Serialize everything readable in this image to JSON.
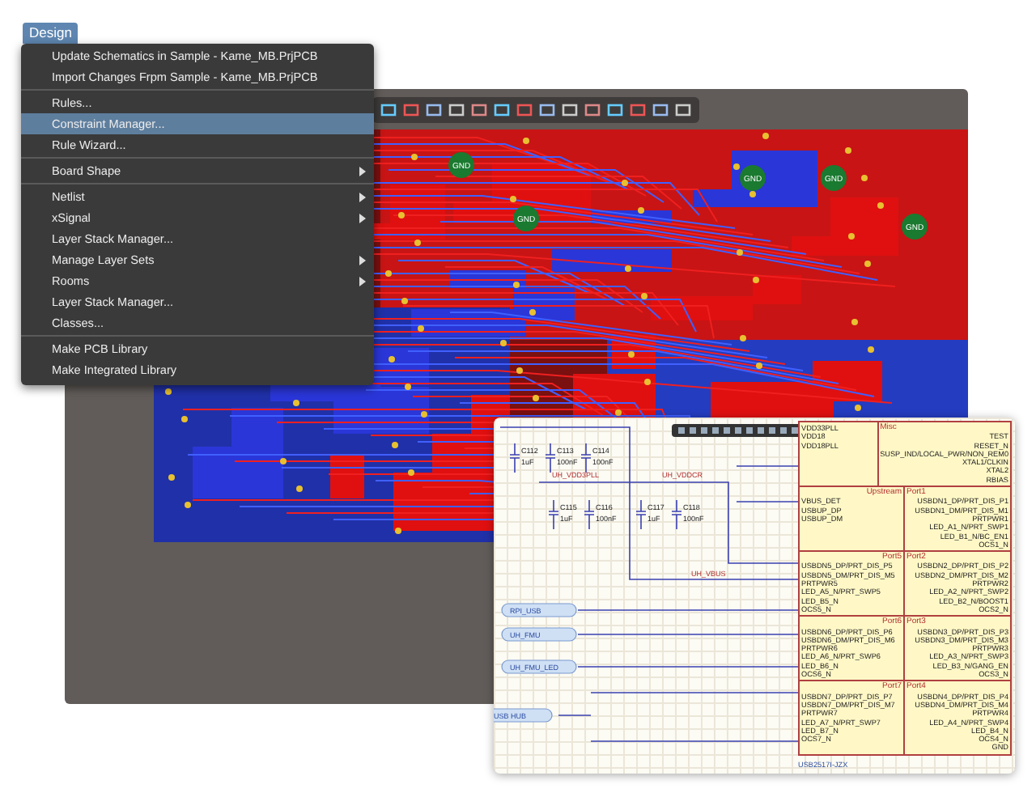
{
  "menu": {
    "title": "Design",
    "items": [
      {
        "label": "Update Schematics in Sample - Kame_MB.PrjPCB",
        "selected": false,
        "submenu": false,
        "group_start": false
      },
      {
        "label": "Import Changes Frpm Sample - Kame_MB.PrjPCB",
        "selected": false,
        "submenu": false,
        "group_start": false
      },
      {
        "label": "Rules...",
        "selected": false,
        "submenu": false,
        "group_start": true
      },
      {
        "label": "Constraint Manager...",
        "selected": true,
        "submenu": false,
        "group_start": false
      },
      {
        "label": "Rule Wizard...",
        "selected": false,
        "submenu": false,
        "group_start": false
      },
      {
        "label": "Board Shape",
        "selected": false,
        "submenu": true,
        "group_start": true
      },
      {
        "label": "Netlist",
        "selected": false,
        "submenu": true,
        "group_start": true
      },
      {
        "label": "xSignal",
        "selected": false,
        "submenu": true,
        "group_start": false
      },
      {
        "label": "Layer Stack Manager...",
        "selected": false,
        "submenu": false,
        "group_start": false
      },
      {
        "label": "Manage Layer Sets",
        "selected": false,
        "submenu": true,
        "group_start": false
      },
      {
        "label": "Rooms",
        "selected": false,
        "submenu": true,
        "group_start": false
      },
      {
        "label": "Layer Stack Manager...",
        "selected": false,
        "submenu": false,
        "group_start": false
      },
      {
        "label": "Classes...",
        "selected": false,
        "submenu": false,
        "group_start": false
      },
      {
        "label": "Make PCB Library",
        "selected": false,
        "submenu": false,
        "group_start": true
      },
      {
        "label": "Make Integrated Library",
        "selected": false,
        "submenu": false,
        "group_start": false
      }
    ]
  },
  "pcb": {
    "pads": [
      "GND",
      "GND",
      "GND",
      "GND",
      "GND"
    ]
  },
  "schematic": {
    "capacitors": [
      {
        "ref": "C112",
        "value": "1uF"
      },
      {
        "ref": "C113",
        "value": "100nF"
      },
      {
        "ref": "C114",
        "value": "100nF"
      },
      {
        "ref": "C115",
        "value": "1uF"
      },
      {
        "ref": "C116",
        "value": "100nF"
      },
      {
        "ref": "C117",
        "value": "1uF"
      },
      {
        "ref": "C118",
        "value": "100nF"
      }
    ],
    "net_labels": [
      "UH_VDD3PLL",
      "UH_VDDCR",
      "UH_VBUS"
    ],
    "harnesses": [
      "RPI_USB",
      "UH_FMU",
      "UH_FMU_LED",
      "USB HUB"
    ],
    "chip": {
      "part": "USB2517I-JZX",
      "sections": [
        {
          "left_pins": [
            "VDD33PLL",
            "VDD18",
            "VDD18PLL"
          ],
          "right_label": "Misc",
          "right_pins": [
            "TEST",
            "RESET_N",
            "SUSP_IND/LOCAL_PWR/NON_REM0",
            "XTAL1/CLKIN",
            "XTAL2",
            "RBIAS"
          ]
        },
        {
          "left_label": "Upstream",
          "left_pins": [
            "VBUS_DET",
            "USBUP_DP",
            "USBUP_DM"
          ],
          "right_label": "Port1",
          "right_pins": [
            "USBDN1_DP/PRT_DIS_P1",
            "USBDN1_DM/PRT_DIS_M1",
            "PRTPWR1",
            "LED_A1_N/PRT_SWP1",
            "LED_B1_N/BC_EN1",
            "OCS1_N"
          ]
        },
        {
          "left_label": "Port5",
          "left_pins": [
            "USBDN5_DP/PRT_DIS_P5",
            "USBDN5_DM/PRT_DIS_M5",
            "PRTPWR5",
            "LED_A5_N/PRT_SWP5",
            "LED_B5_N",
            "OCS5_N"
          ],
          "right_label": "Port2",
          "right_pins": [
            "USBDN2_DP/PRT_DIS_P2",
            "USBDN2_DM/PRT_DIS_M2",
            "PRTPWR2",
            "LED_A2_N/PRT_SWP2",
            "LED_B2_N/BOOST1",
            "OCS2_N"
          ]
        },
        {
          "left_label": "Port6",
          "left_pins": [
            "USBDN6_DP/PRT_DIS_P6",
            "USBDN6_DM/PRT_DIS_M6",
            "PRTPWR6",
            "LED_A6_N/PRT_SWP6",
            "LED_B6_N",
            "OCS6_N"
          ],
          "right_label": "Port3",
          "right_pins": [
            "USBDN3_DP/PRT_DIS_P3",
            "USBDN3_DM/PRT_DIS_M3",
            "PRTPWR3",
            "LED_A3_N/PRT_SWP3",
            "LED_B3_N/GANG_EN",
            "OCS3_N"
          ]
        },
        {
          "left_label": "Port7",
          "left_pins": [
            "USBDN7_DP/PRT_DIS_P7",
            "USBDN7_DM/PRT_DIS_M7",
            "PRTPWR7",
            "LED_A7_N/PRT_SWP7",
            "LED_B7_N",
            "OCS7_N"
          ],
          "right_label": "Port4",
          "right_pins": [
            "USBDN4_DP/PRT_DIS_P4",
            "USBDN4_DM/PRT_DIS_M4",
            "PRTPWR4",
            "LED_A4_N/PRT_SWP4",
            "LED_B4_N",
            "OCS4_N",
            "GND"
          ]
        }
      ]
    }
  }
}
